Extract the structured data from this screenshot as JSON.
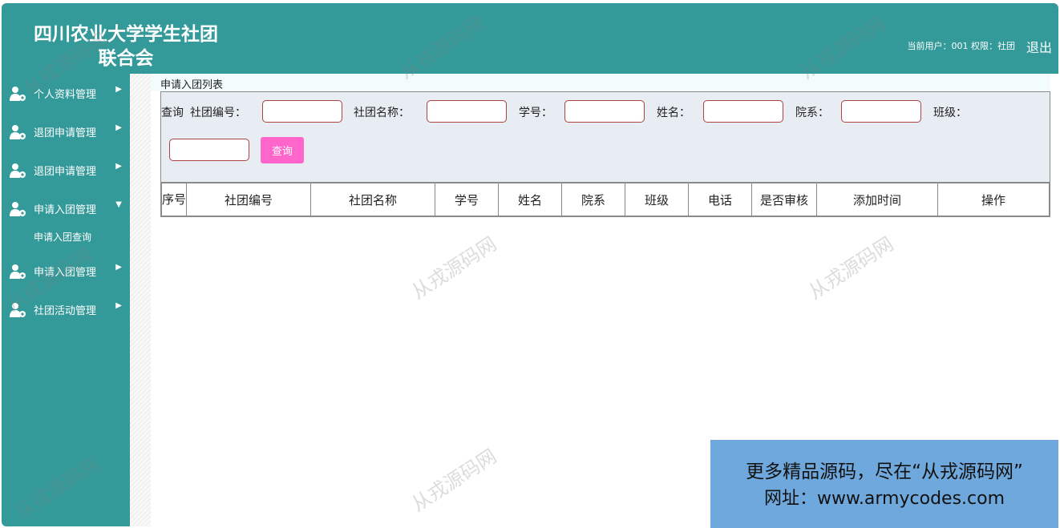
{
  "header": {
    "title_line1": "四川农业大学学生社团",
    "title_line2": "联合会",
    "user_info": "当前用户：001 权限：社团",
    "logout_label": "退出"
  },
  "sidebar": {
    "items": [
      {
        "label": "个人资料管理",
        "icon": "user-gear-icon",
        "arrow": "▶"
      },
      {
        "label": "退团申请管理",
        "icon": "user-gear-icon",
        "arrow": "▶"
      },
      {
        "label": "退团申请管理",
        "icon": "user-gear-icon",
        "arrow": "▶"
      },
      {
        "label": "申请入团管理",
        "icon": "user-gear-icon",
        "arrow": "▼"
      },
      {
        "label": "申请入团管理",
        "icon": "user-gear-icon",
        "arrow": "▶"
      },
      {
        "label": "社团活动管理",
        "icon": "user-gear-icon",
        "arrow": "▶"
      }
    ],
    "submenu_label": "申请入团查询"
  },
  "breadcrumb": "申请入团列表",
  "search": {
    "prefix": "查询",
    "fields": [
      {
        "label": "社团编号：",
        "value": ""
      },
      {
        "label": "社团名称：",
        "value": ""
      },
      {
        "label": "学号：",
        "value": ""
      },
      {
        "label": "姓名：",
        "value": ""
      },
      {
        "label": "院系：",
        "value": ""
      },
      {
        "label": "班级：",
        "value": ""
      }
    ],
    "button_label": "查询"
  },
  "table": {
    "columns": [
      "序号",
      "社团编号",
      "社团名称",
      "学号",
      "姓名",
      "院系",
      "班级",
      "电话",
      "是否审核",
      "添加时间",
      "操作"
    ]
  },
  "watermark": "从戎源码网",
  "promo": {
    "line1": "更多精品源码，尽在“从戎源码网”",
    "line2": "网址：www.armycodes.com"
  },
  "colors": {
    "header_bg": "#339999",
    "sidebar_bg": "#339999",
    "button_bg": "#ff66cc",
    "promo_bg": "#6fa8dc"
  }
}
